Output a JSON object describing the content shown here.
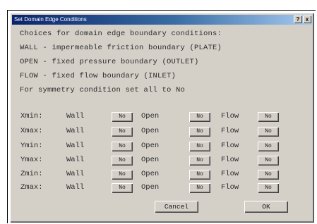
{
  "window": {
    "title": "Set Domain Edge Conditions",
    "help_label": "?",
    "close_label": "x"
  },
  "instructions": [
    "Choices for domain edge boundary conditions:",
    "WALL - impermeable friction boundary (PLATE)",
    "OPEN - fixed pressure boundary (OUTLET)",
    "FLOW - fixed flow boundary (INLET)",
    "For symmetry condition set all to No"
  ],
  "columns": {
    "wall_label": "Wall",
    "open_label": "Open",
    "flow_label": "Flow"
  },
  "rows": [
    {
      "axis": "Xmin:",
      "wall": "No",
      "open": "No",
      "flow": "No"
    },
    {
      "axis": "Xmax:",
      "wall": "No",
      "open": "No",
      "flow": "No"
    },
    {
      "axis": "Ymin:",
      "wall": "No",
      "open": "No",
      "flow": "No"
    },
    {
      "axis": "Ymax:",
      "wall": "No",
      "open": "No",
      "flow": "No"
    },
    {
      "axis": "Zmin:",
      "wall": "No",
      "open": "No",
      "flow": "No"
    },
    {
      "axis": "Zmax:",
      "wall": "No",
      "open": "No",
      "flow": "No"
    }
  ],
  "actions": {
    "cancel_label": "Cancel",
    "ok_label": "OK"
  },
  "colors": {
    "dialog_background": "#d4d0c8",
    "titlebar_start": "#0a246a",
    "titlebar_end": "#a6caf0"
  }
}
